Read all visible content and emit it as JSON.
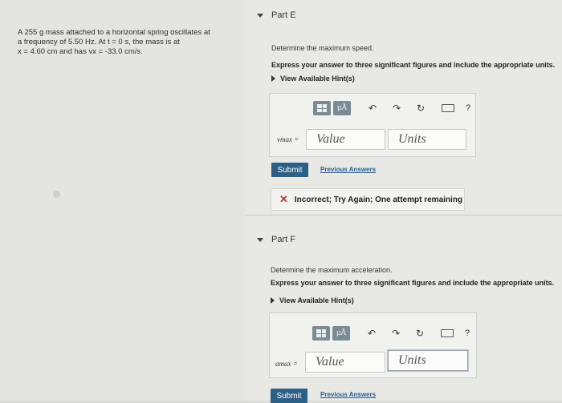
{
  "problem": {
    "line1": "A 255 g mass attached to a horizontal spring oscillates at",
    "line2": "a frequency of 5.50 Hz. At t = 0 s, the mass is at",
    "line3": "x = 4.60 cm and has vx = -33.0 cm/s."
  },
  "partE": {
    "title": "Part E",
    "question": "Determine the maximum speed.",
    "instruction": "Express your answer to three significant figures and include the appropriate units.",
    "hint": "View Available Hint(s)",
    "var_label": "vmax =",
    "value_placeholder": "Value",
    "units_placeholder": "Units",
    "submit": "Submit",
    "previous": "Previous Answers",
    "feedback": "Incorrect; Try Again; One attempt remaining"
  },
  "partF": {
    "title": "Part F",
    "question": "Determine the maximum acceleration.",
    "instruction": "Express your answer to three significant figures and include the appropriate units.",
    "hint": "View Available Hint(s)",
    "var_label": "amax =",
    "value_placeholder": "Value",
    "units_placeholder": "Units",
    "submit": "Submit",
    "previous": "Previous Answers"
  },
  "toolbar": {
    "mu_label": "μÅ",
    "help": "?"
  }
}
